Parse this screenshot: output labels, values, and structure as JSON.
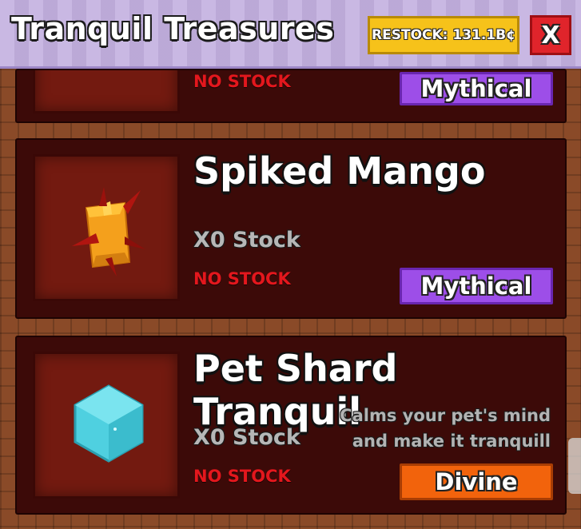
{
  "header": {
    "title": "Tranquil Treasures",
    "restock_label": "RESTOCK: 131.1B¢",
    "close_label": "X"
  },
  "items": [
    {
      "name": "",
      "stock_count": "",
      "stock_status": "NO STOCK",
      "rarity": "Mythical",
      "rarity_color": "#9d4ee8",
      "icon": "item-icon-hidden"
    },
    {
      "name": "Spiked Mango",
      "stock_count": "X0 Stock",
      "stock_status": "NO STOCK",
      "rarity": "Mythical",
      "rarity_color": "#9d4ee8",
      "icon": "spiked-mango-icon"
    },
    {
      "name": "Pet Shard Tranquil",
      "stock_count": "X0 Stock",
      "stock_status": "NO STOCK",
      "description_line1": "Calms your pet's mind",
      "description_line2": "and make it tranquill",
      "rarity": "Divine",
      "rarity_color": "#f2630c",
      "icon": "pet-shard-icon"
    }
  ],
  "colors": {
    "header_bg": "#c3b0e0",
    "restock_bg": "#f6c21a",
    "close_bg": "#e0242b",
    "card_bg": "#3c0a08",
    "no_stock": "#e3171d"
  }
}
